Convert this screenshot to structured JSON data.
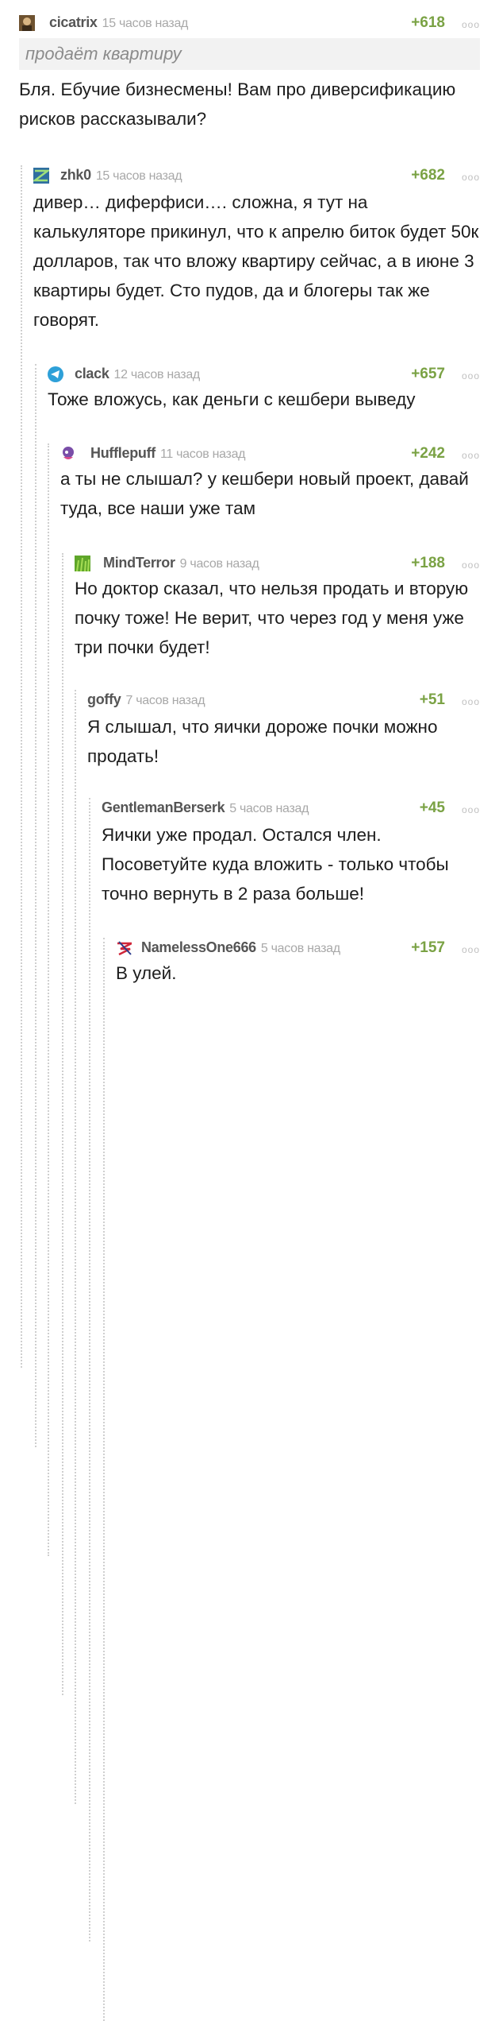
{
  "comments": [
    {
      "user": "cicatrix",
      "time": "15 часов назад",
      "rating": "+618",
      "menu": "ooo",
      "quote": "продаёт квартиру",
      "text": "Бля. Ебучие бизнесмены! Вам про диверсификацию рисков рассказывали?"
    },
    {
      "user": "zhk0",
      "time": "15 часов назад",
      "rating": "+682",
      "menu": "ooo",
      "text": "дивер… диферфиси…. сложна, я тут на калькуляторе прикинул, что к апрелю биток будет 50к долларов, так что вложу квартиру сейчас, а в июне 3 квартиры будет. Сто пудов, да и блогеры так же говорят."
    },
    {
      "user": "clack",
      "time": "12 часов назад",
      "rating": "+657",
      "menu": "ooo",
      "text": "Тоже вложусь, как деньги с кешбери выведу"
    },
    {
      "user": "Hufflepuff",
      "time": "11 часов назад",
      "rating": "+242",
      "menu": "ooo",
      "text": "а ты не слышал? у кешбери новый проект, давай туда, все наши уже там"
    },
    {
      "user": "MindTerror",
      "time": "9 часов назад",
      "rating": "+188",
      "menu": "ooo",
      "text": "Но доктор сказал, что нельзя продать и вторую почку тоже! Не верит, что через год у меня уже три почки будет!"
    },
    {
      "user": "goffy",
      "time": "7 часов назад",
      "rating": "+51",
      "menu": "ooo",
      "text": "Я слышал, что яички дороже почки можно продать!"
    },
    {
      "user": "GentlemanBerserk",
      "time": "5 часов назад",
      "rating": "+45",
      "menu": "ooo",
      "text": "Яички уже продал. Остался член. Посоветуйте куда вложить - только чтобы точно вернуть в 2 раза больше!"
    },
    {
      "user": "NamelessOne666",
      "time": "5 часов назад",
      "rating": "+157",
      "menu": "ooo",
      "text": "В улей."
    }
  ]
}
